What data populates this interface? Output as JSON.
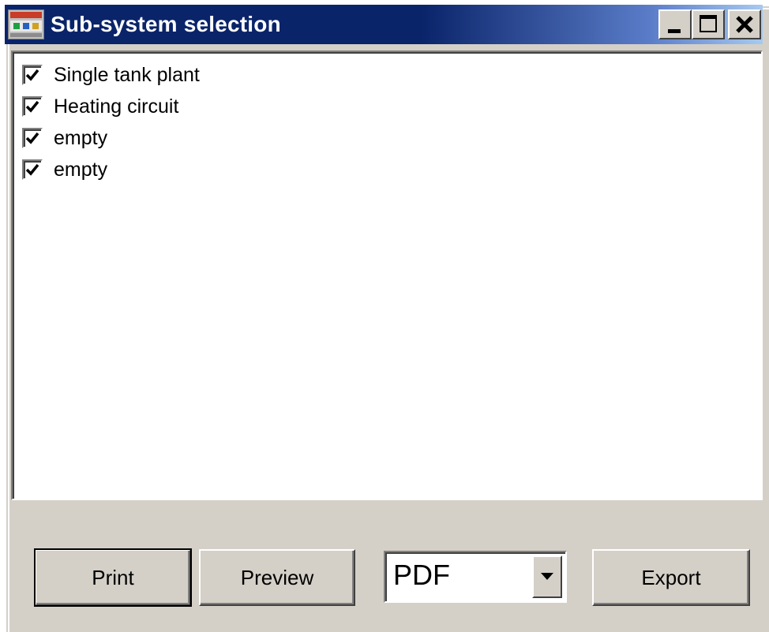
{
  "window": {
    "title": "Sub-system selection",
    "controls": {
      "minimize_icon": "minimize-icon",
      "maximize_icon": "maximize-icon",
      "close_icon": "close-icon"
    }
  },
  "subsystems": {
    "items": [
      {
        "label": "Single tank plant",
        "checked": true
      },
      {
        "label": "Heating circuit",
        "checked": true
      },
      {
        "label": "empty",
        "checked": true
      },
      {
        "label": "empty",
        "checked": true
      }
    ]
  },
  "actions": {
    "print_label": "Print",
    "preview_label": "Preview",
    "export_label": "Export",
    "format": {
      "selected": "PDF"
    }
  },
  "colors": {
    "titlebar_start": "#0a246a",
    "titlebar_end": "#a6caf0",
    "dialog_face": "#d4d0c8"
  }
}
